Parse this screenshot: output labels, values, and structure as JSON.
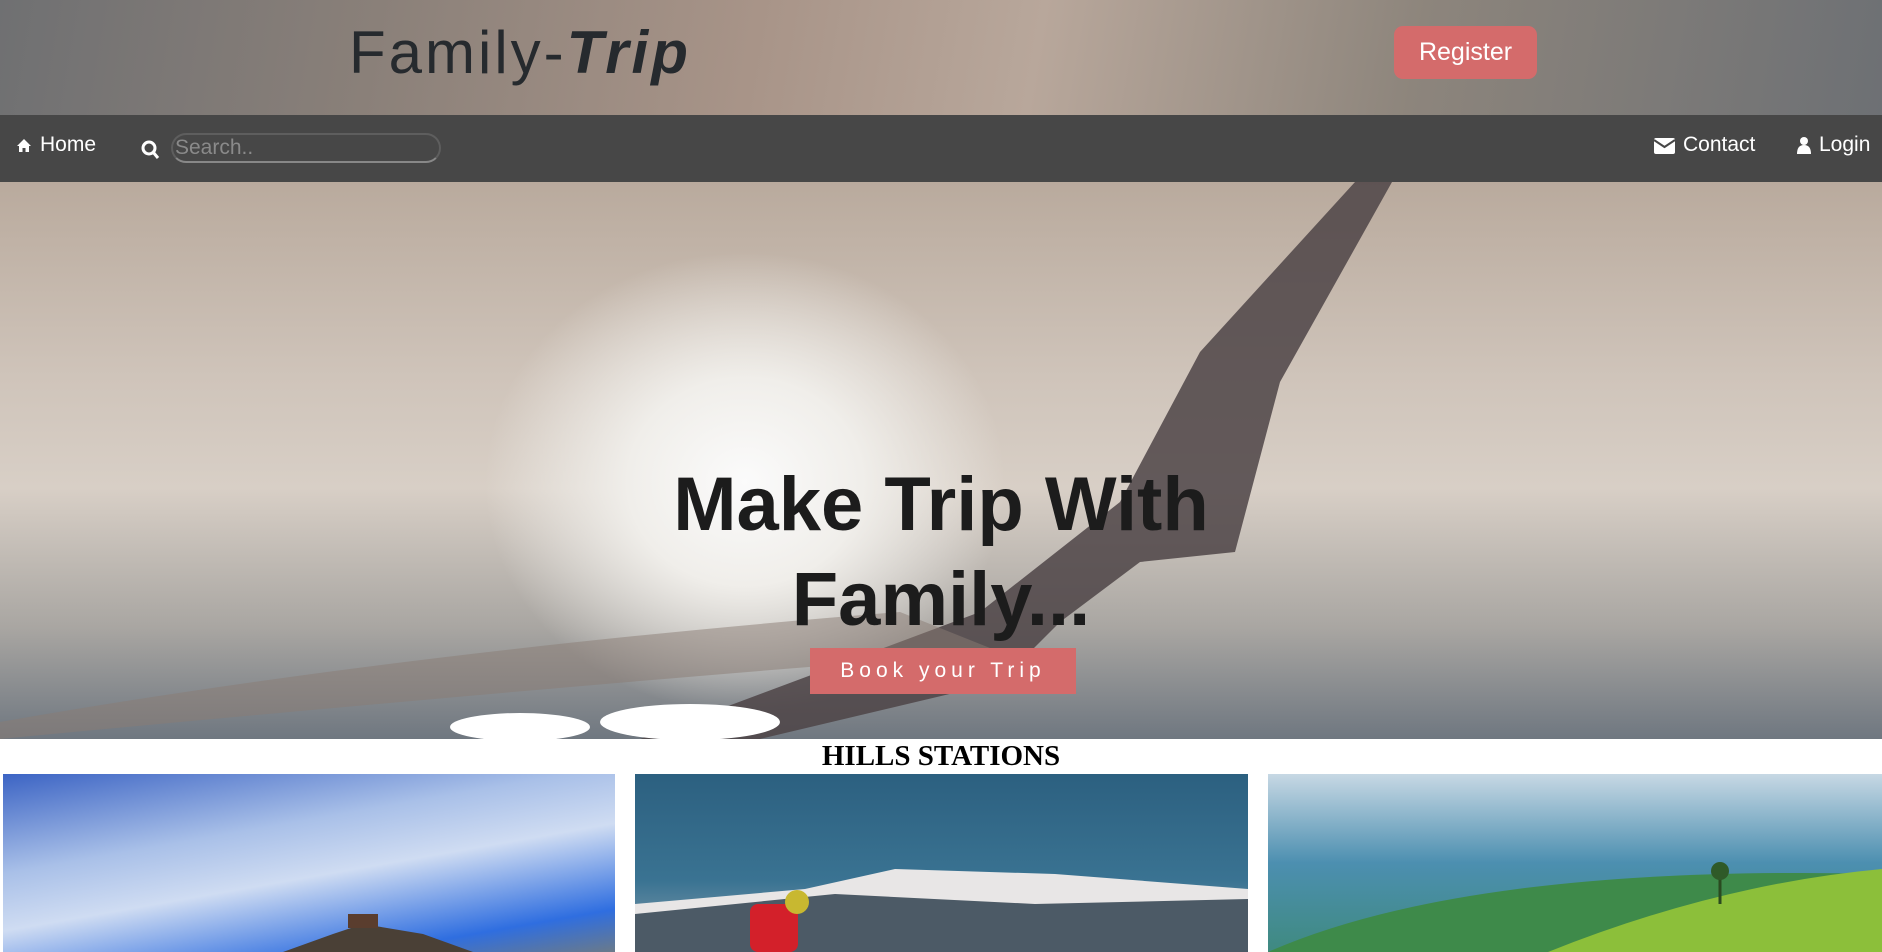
{
  "header": {
    "logo_main": "Family-",
    "logo_emphasis": "Trip",
    "register_label": "Register"
  },
  "nav": {
    "home_label": "Home",
    "search_placeholder": "Search..",
    "contact_label": "Contact",
    "login_label": "Login"
  },
  "hero": {
    "heading_line1": "Make Trip With",
    "heading_line2": "Family...",
    "cta_label": "Book your Trip"
  },
  "section": {
    "title": "HILLS STATIONS"
  },
  "colors": {
    "accent": "#d46b6b",
    "nav_bg": "#474747"
  }
}
